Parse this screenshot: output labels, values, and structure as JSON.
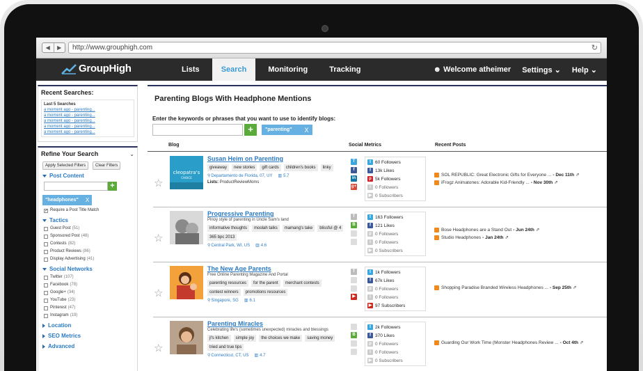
{
  "browser": {
    "url": "http://www.grouphigh.com",
    "back": "◀",
    "forward": "▶",
    "reload": "↻"
  },
  "header": {
    "logo_text": "GroupHigh",
    "nav": [
      "Lists",
      "Search",
      "Monitoring",
      "Tracking"
    ],
    "active_nav": "Search",
    "welcome": "Welcome atheimer",
    "settings": "Settings",
    "help": "Help"
  },
  "sidebar": {
    "recent_title": "Recent Searches:",
    "last5_label": "Last 5 Searches",
    "recent_items": [
      "a moment ago - parenting...",
      "a moment ago - parenting...",
      "a moment ago - parenting...",
      "a moment ago - parenting...",
      "a moment ago - parenting..."
    ],
    "refine_title": "Refine Your Search",
    "apply_btn": "Apply Selected Filters",
    "clear_btn": "Clear Filters",
    "post_content_label": "Post Content",
    "post_tag": "\"headphones\"",
    "post_tag_x": "X",
    "require_title": "Require a Post Title Match",
    "tactics_label": "Tactics",
    "tactics": [
      {
        "name": "Guest Post",
        "count": "(51)"
      },
      {
        "name": "Sponsored Post",
        "count": "(48)"
      },
      {
        "name": "Contests",
        "count": "(82)"
      },
      {
        "name": "Product Reviews",
        "count": "(86)"
      },
      {
        "name": "Display Advertising",
        "count": "(41)"
      }
    ],
    "social_label": "Social Networks",
    "social": [
      {
        "name": "Twitter",
        "count": "(107)"
      },
      {
        "name": "Facebook",
        "count": "(78)"
      },
      {
        "name": "Google+",
        "count": "(34)"
      },
      {
        "name": "YouTube",
        "count": "(23)"
      },
      {
        "name": "Pinterest",
        "count": "(47)"
      },
      {
        "name": "Instagram",
        "count": "(19)"
      }
    ],
    "location_label": "Location",
    "seo_label": "SEO Metrics",
    "advanced_label": "Advanced"
  },
  "main": {
    "title": "Parenting Blogs With Headphone Mentions",
    "kw_label": "Enter the keywords or phrases that you want to use to identify blogs:",
    "kw_plus": "+",
    "kw_chip": "\"parenting\"",
    "kw_chip_x": "X",
    "col_blog": "Blog",
    "col_social": "Social Metrics",
    "col_posts": "Recent Posts",
    "lists_label": "Lists:",
    "rows": [
      {
        "title": "Susan Heim on Parenting",
        "desc": "",
        "tags": [
          "giveaway",
          "new stories",
          "gift cards",
          "children's books",
          "linky"
        ],
        "location": "Departamento de Florida, 07, UY",
        "rank": "5.7",
        "lists": "ProductReviewMoms",
        "metrics": [
          "60 Followers",
          "13k Likes",
          "5k Followers",
          "0 Followers",
          "0 Subscribers"
        ],
        "posts": [
          {
            "text": "SOL REPUBLIC: Great Electronic Gifts for Everyone ...",
            "date": "- Dec 11th"
          },
          {
            "text": "iFrogz Animatones: Adorable Kid-Friendly ...",
            "date": "- Nov 30th"
          }
        ]
      },
      {
        "title": "Progressive Parenting",
        "desc": "Pinoy style of parenting in Uncle Sam's land",
        "tags": [
          "informative thoughts",
          "moolah talks",
          "mamang's take",
          "blissful @ 4",
          "365 bpc 2013"
        ],
        "location": "Central Park, WI, US",
        "rank": "4.6",
        "metrics": [
          "163 Followers",
          "121 Likes",
          "0 Followers",
          "0 Followers",
          "0 Subscribers"
        ],
        "posts": [
          {
            "text": "Bose Headphones are a Stand Out",
            "date": "- Jun 24th"
          },
          {
            "text": "Studio Headphones",
            "date": "- Jan 24th"
          }
        ]
      },
      {
        "title": "The New Age Parents",
        "desc": "Free Online Parenting Magazine And Portal",
        "tags": [
          "parenting resources",
          "for the parent",
          "merchant contests",
          "contest winners",
          "promotions resources"
        ],
        "location": "Singapore, SG",
        "rank": "6.1",
        "metrics": [
          "1k Followers",
          "67k Likes",
          "0 Followers",
          "0 Followers",
          "97 Subscribers"
        ],
        "posts": [
          {
            "text": "Shopping Paradise Branded Wireless Headphones ...",
            "date": "- Sep 25th"
          }
        ]
      },
      {
        "title": "Parenting Miracles",
        "desc": "Celebrating life's (sometimes unexpected) miracles and blessings",
        "tags": [
          "jl's kitchen",
          "simple joy",
          "the choices we make",
          "saving money",
          "tried and true tips"
        ],
        "location": "Connecticut, CT, US",
        "rank": "4.7",
        "metrics": [
          "2k Followers",
          "370 Likes",
          "0 Followers",
          "0 Followers",
          "0 Subscribers"
        ],
        "posts": [
          {
            "text": "Guarding Our Work Time (Monster Headphones Review ...",
            "date": "- Oct 4th"
          }
        ]
      }
    ]
  },
  "colors": {
    "header_bg": "#2b2b2b",
    "accent_blue": "#3a9bd4",
    "link_blue": "#2a7ac4",
    "plus_green": "#5aab3a",
    "chip_blue": "#67b0e2",
    "rss_orange": "#f08a1c",
    "twitter": "#3aa6e0",
    "facebook": "#3b5998",
    "linkedin": "#0e76a8",
    "google_plus": "#d34836",
    "youtube": "#cc2a1e",
    "pinterest": "#cb2027"
  }
}
